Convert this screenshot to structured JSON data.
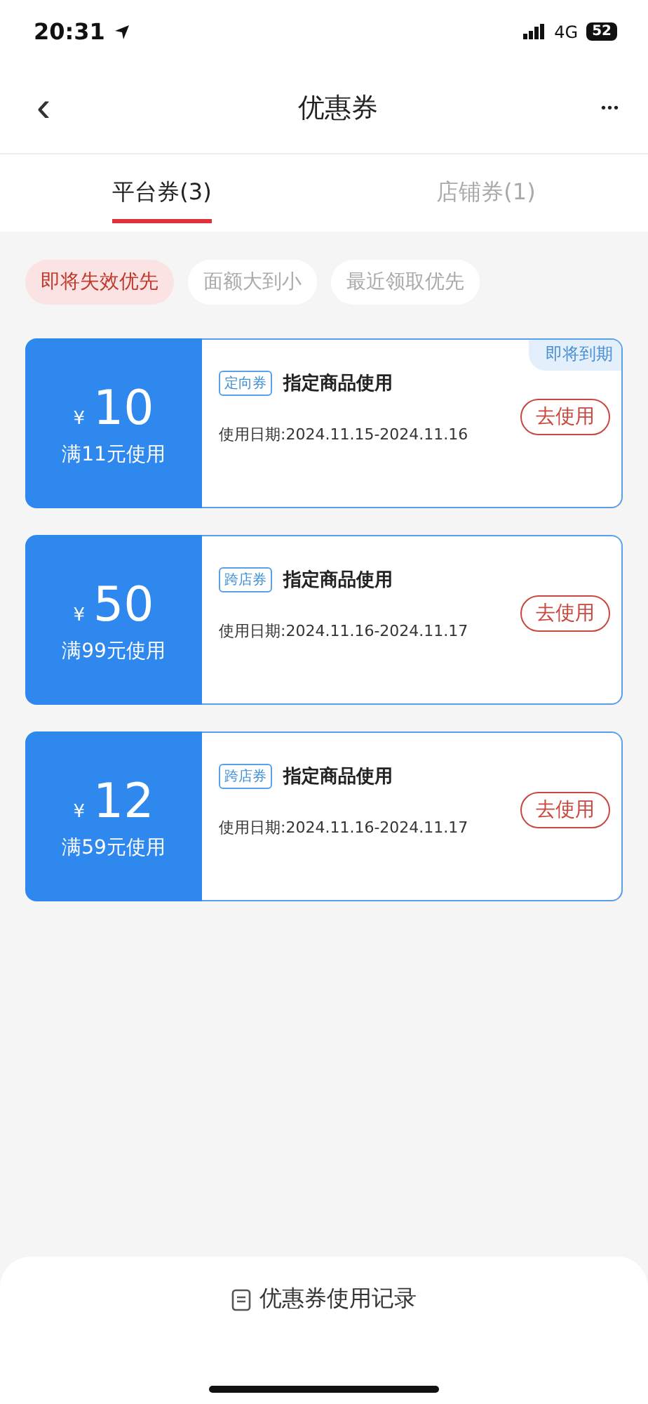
{
  "status_bar": {
    "time": "20:31",
    "network": "4G",
    "battery": "52"
  },
  "nav": {
    "back": "‹",
    "title": "优惠券",
    "more": "•••"
  },
  "tabs": [
    {
      "label": "平台券(3)",
      "selected": true
    },
    {
      "label": "店铺券(1)",
      "selected": false
    }
  ],
  "filters": [
    {
      "label": "即将失效优先",
      "selected": true
    },
    {
      "label": "面额大到小",
      "selected": false
    },
    {
      "label": "最近领取优先",
      "selected": false
    }
  ],
  "coupons": [
    {
      "currency": "¥",
      "amount": "10",
      "condition": "满11元使用",
      "tag": "定向券",
      "title": "指定商品使用",
      "dates": "使用日期:2024.11.15-2024.11.16",
      "badge": "即将到期",
      "action": "去使用"
    },
    {
      "currency": "¥",
      "amount": "50",
      "condition": "满99元使用",
      "tag": "跨店券",
      "title": "指定商品使用",
      "dates": "使用日期:2024.11.16-2024.11.17",
      "action": "去使用"
    },
    {
      "currency": "¥",
      "amount": "12",
      "condition": "满59元使用",
      "tag": "跨店券",
      "title": "指定商品使用",
      "dates": "使用日期:2024.11.16-2024.11.17",
      "action": "去使用"
    }
  ],
  "footer": {
    "link": "优惠券使用记录"
  }
}
